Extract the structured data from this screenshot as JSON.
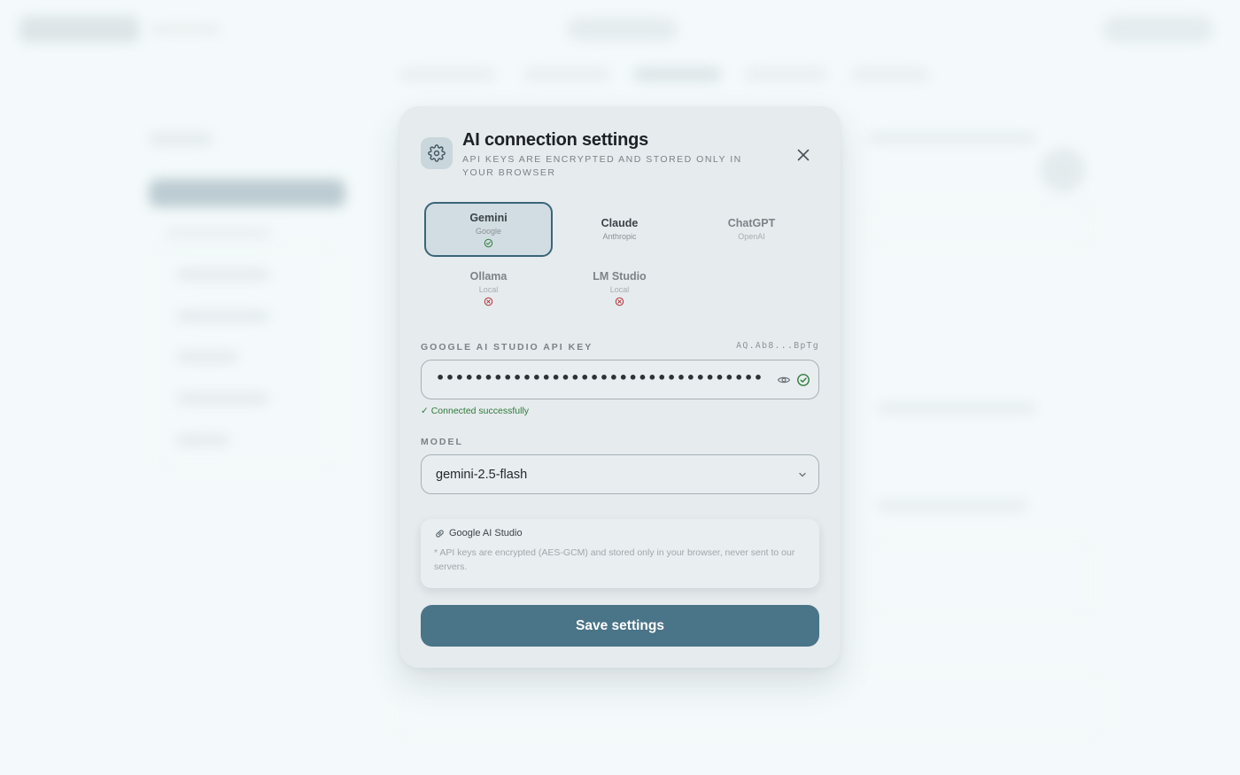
{
  "modal": {
    "title": "AI connection settings",
    "subtitle": "API keys are encrypted and stored only in your browser",
    "close_icon": "close-icon",
    "header_icon": "gear-icon"
  },
  "providers": [
    {
      "name": "Gemini",
      "vendor": "Google",
      "selected": true,
      "status": "connected"
    },
    {
      "name": "Claude",
      "vendor": "Anthropic",
      "selected": false,
      "status": "none"
    },
    {
      "name": "ChatGPT",
      "vendor": "OpenAI",
      "selected": false,
      "status": "none"
    },
    {
      "name": "Ollama",
      "vendor": "Local",
      "selected": false,
      "status": "error"
    },
    {
      "name": "LM Studio",
      "vendor": "Local",
      "selected": false,
      "status": "error"
    }
  ],
  "api_key": {
    "label": "Google AI Studio API Key",
    "preview": "AQ.Ab8...BpTg",
    "masked_value": "•••••••••••••••••••••••••••••••••••••••••••••",
    "status_text": "✓ Connected successfully"
  },
  "model": {
    "label": "Model",
    "selected": "gemini-2.5-flash"
  },
  "info": {
    "link_text": "Google AI Studio",
    "note": "* API keys are encrypted (AES-GCM) and stored only in your browser, never sent to our servers."
  },
  "save_button": "Save settings",
  "colors": {
    "accent": "#4a7488",
    "selected_border": "#3a6478",
    "success": "#2f7b3a",
    "error": "#b3323a"
  }
}
